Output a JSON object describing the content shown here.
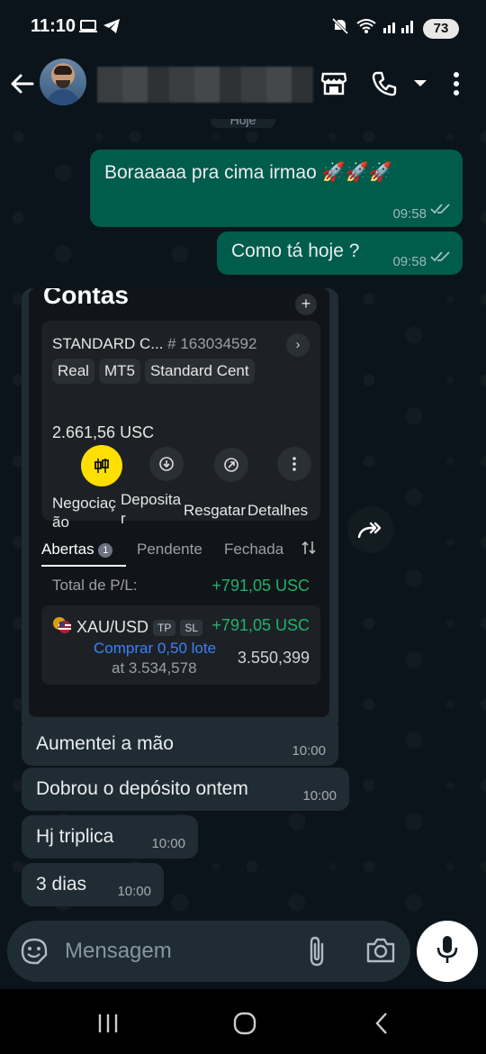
{
  "status_bar": {
    "time": "11:10",
    "battery": "73"
  },
  "header": {
    "date_chip": "Hoje"
  },
  "messages": {
    "out1": {
      "text": "Boraaaaa pra cima irmao 🚀🚀🚀",
      "time": "09:58"
    },
    "out2": {
      "text": "Como tá hoje ?",
      "time": "09:58"
    },
    "image": {
      "title": "Contas",
      "plus": "+",
      "account_name": "STANDARD C...",
      "account_number": "# 163034592",
      "chips": [
        "Real",
        "MT5",
        "Standard Cent"
      ],
      "balance": "2.661,56 USC",
      "actions": {
        "trade_line1": "Negociaç",
        "trade_line2": "ão",
        "deposit_line1": "Deposita",
        "deposit_line2": "r",
        "withdraw": "Resgatar",
        "details": "Detalhes"
      },
      "tabs": {
        "open": "Abertas",
        "open_count": "1",
        "pending": "Pendente",
        "closed": "Fechada"
      },
      "total_pl_label": "Total de P/L:",
      "total_pl_value": "+791,05 USC",
      "position": {
        "symbol": "XAU/USD",
        "tp": "TP",
        "sl": "SL",
        "pl": "+791,05 USC",
        "direction": "Comprar 0,50 lote",
        "open_price": "at 3.534,578",
        "current_price": "3.550,399"
      }
    },
    "in1": {
      "text": "Aumentei a mão",
      "time": "10:00"
    },
    "in2": {
      "text": "Dobrou o depósito ontem",
      "time": "10:00"
    },
    "in3": {
      "text": "Hj triplica",
      "time": "10:00"
    },
    "in4": {
      "text": "3 dias",
      "time": "10:00"
    }
  },
  "input": {
    "placeholder": "Mensagem"
  },
  "colors": {
    "outgoing": "#005c4b",
    "incoming": "#202c33",
    "profit": "#20b26c",
    "buy": "#3b82f6",
    "trade_accent": "#ffde02"
  },
  "icons": [
    "back-arrow-icon",
    "shop-icon",
    "phone-icon",
    "chevron-down-icon",
    "more-vert-icon",
    "forward-icon",
    "emoji-icon",
    "attach-icon",
    "camera-icon",
    "mic-icon"
  ]
}
